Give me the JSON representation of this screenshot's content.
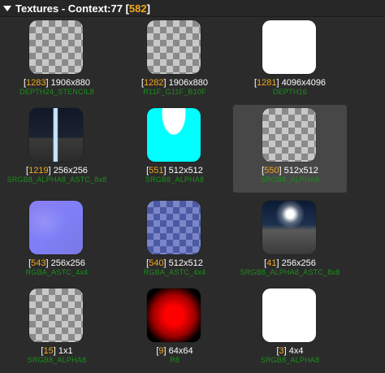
{
  "header": {
    "prefix": "Textures - Context:77 [",
    "count": "582",
    "suffix": "]"
  },
  "textures": [
    {
      "id": "1283",
      "size": "1906x880",
      "format": "DEPTH24_STENCIL8",
      "kind": "checker",
      "selected": false
    },
    {
      "id": "1282",
      "size": "1906x880",
      "format": "R11F_G11F_B10F",
      "kind": "checker",
      "selected": false
    },
    {
      "id": "1281",
      "size": "4096x4096",
      "format": "DEPTH16",
      "kind": "white",
      "selected": false
    },
    {
      "id": "1219",
      "size": "256x256",
      "format": "SRGB8_ALPHA8_ASTC_8x8",
      "kind": "photo-night",
      "selected": false
    },
    {
      "id": "551",
      "size": "512x512",
      "format": "SRGB8_ALPHA8",
      "kind": "cyan",
      "selected": false
    },
    {
      "id": "550",
      "size": "512x512",
      "format": "SRGB8_ALPHA8",
      "kind": "checker",
      "selected": true
    },
    {
      "id": "543",
      "size": "256x256",
      "format": "RGBA_ASTC_4x4",
      "kind": "normal",
      "selected": false
    },
    {
      "id": "540",
      "size": "512x512",
      "format": "RGBA_ASTC_4x4",
      "kind": "bluechecker",
      "selected": false
    },
    {
      "id": "41",
      "size": "256x256",
      "format": "SRGB8_ALPHA8_ASTC_8x8",
      "kind": "photo-sky",
      "selected": false
    },
    {
      "id": "15",
      "size": "1x1",
      "format": "SRGB8_ALPHA8",
      "kind": "checker",
      "selected": false
    },
    {
      "id": "9",
      "size": "64x64",
      "format": "R8",
      "kind": "red",
      "selected": false
    },
    {
      "id": "3",
      "size": "4x4",
      "format": "SRGB8_ALPHA8",
      "kind": "white",
      "selected": false
    }
  ],
  "colors": {
    "background": "#2b2b2b",
    "index_accent": "#f3a71b",
    "format_text": "#1a8f1a",
    "selected_bg": "#474747"
  }
}
